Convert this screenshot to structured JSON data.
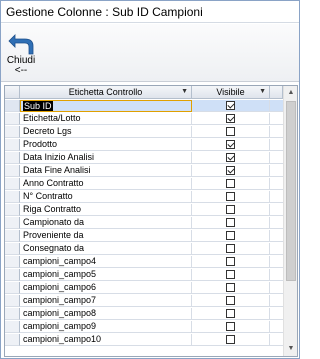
{
  "window": {
    "title": "Gestione Colonne : Sub ID Campioni"
  },
  "toolbar": {
    "close_label": "Chiudi",
    "close_shortcut": "<--"
  },
  "grid": {
    "columns": [
      "Etichetta Controllo",
      "Visibile"
    ],
    "rows": [
      {
        "label": "Sub ID",
        "visible": true
      },
      {
        "label": "Etichetta/Lotto",
        "visible": true
      },
      {
        "label": "Decreto Lgs",
        "visible": false
      },
      {
        "label": "Prodotto",
        "visible": true
      },
      {
        "label": "Data Inizio Analisi",
        "visible": true
      },
      {
        "label": "Data Fine Analisi",
        "visible": true
      },
      {
        "label": "Anno Contratto",
        "visible": false
      },
      {
        "label": "N° Contratto",
        "visible": false
      },
      {
        "label": "Riga Contratto",
        "visible": false
      },
      {
        "label": "Campionato da",
        "visible": false
      },
      {
        "label": "Proveniente da",
        "visible": false
      },
      {
        "label": "Consegnato da",
        "visible": false
      },
      {
        "label": "campioni_campo4",
        "visible": false
      },
      {
        "label": "campioni_campo5",
        "visible": false
      },
      {
        "label": "campioni_campo6",
        "visible": false
      },
      {
        "label": "campioni_campo7",
        "visible": false
      },
      {
        "label": "campioni_campo8",
        "visible": false
      },
      {
        "label": "campioni_campo9",
        "visible": false
      },
      {
        "label": "campioni_campo10",
        "visible": false
      }
    ]
  }
}
